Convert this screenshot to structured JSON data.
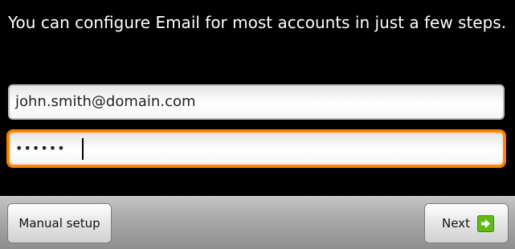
{
  "intro_text": "You can configure Email for most accounts in just a few steps.",
  "email_field": {
    "value": "john.smith@domain.com"
  },
  "password_field": {
    "masked_value": "••••••"
  },
  "buttons": {
    "manual_setup": "Manual setup",
    "next": "Next"
  },
  "icons": {
    "next": "next-arrow-icon"
  },
  "colors": {
    "focus_border": "#ff8c00",
    "next_icon_green": "#5dbb12"
  }
}
